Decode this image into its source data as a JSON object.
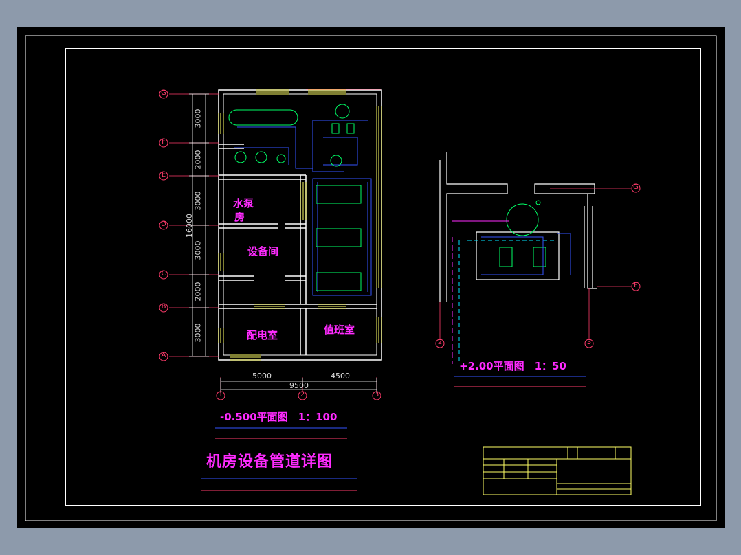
{
  "plan_main": {
    "rooms": {
      "pump_room_line1": "水泵",
      "pump_room_line2": "房",
      "equipment_room": "设备间",
      "power_room": "配电室",
      "duty_room": "值班室"
    },
    "row_axes": [
      "G",
      "F",
      "E",
      "D",
      "C",
      "B",
      "A"
    ],
    "col_axes": [
      "1",
      "2",
      "3"
    ],
    "vertical_dims": [
      "3000",
      "2000",
      "3000",
      "3000",
      "2000",
      "3000"
    ],
    "total_height": "16000",
    "horizontal_dims": [
      "5000",
      "4500"
    ],
    "total_width": "9500",
    "title": "-0.500平面图　1：100"
  },
  "plan_detail": {
    "title": "+2.00平面图　1：50",
    "axes": [
      "G",
      "F",
      "2",
      "3"
    ]
  },
  "drawing_title": "机房设备管道详图",
  "colors": {
    "background": "#000000",
    "border": "#ffffff",
    "text": "#ff2bff",
    "axis": "#ff3b6b",
    "pipe": "#3355ff",
    "equipment": "#00ff66",
    "wall": "#ffffff",
    "window": "#ffff66",
    "dim": "#d9d9d9"
  }
}
